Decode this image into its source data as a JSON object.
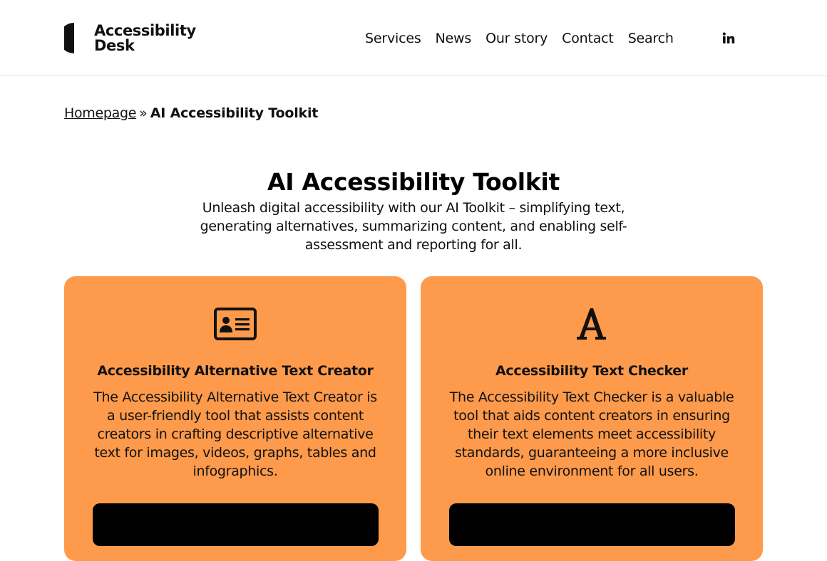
{
  "header": {
    "logo_line1": "Accessibility",
    "logo_line2": "Desk",
    "nav": [
      "Services",
      "News",
      "Our story",
      "Contact",
      "Search"
    ],
    "social_icon": "linkedin-icon"
  },
  "breadcrumb": {
    "home": "Homepage",
    "separator": "»",
    "current": "AI Accessibility Toolkit"
  },
  "hero": {
    "title": "AI Accessibility Toolkit",
    "description": "Unleash digital accessibility with our AI Toolkit – simplifying text, generating alternatives, summarizing content, and enabling self-assessment and reporting for all."
  },
  "cards": [
    {
      "icon": "id-card-icon",
      "title": "Accessibility Alternative Text Creator",
      "description": "The Accessibility Alternative Text Creator is a user-friendly tool that assists content creators in crafting descriptive alternative text for images, videos, graphs, tables and infographics."
    },
    {
      "icon": "font-letter-a-icon",
      "title": "Accessibility Text Checker",
      "description": "The Accessibility Text Checker is a valuable tool that aids content creators in ensuring their text elements meet accessibility standards, guaranteeing a more inclusive online environment for all users."
    }
  ],
  "colors": {
    "card_background": "#fd9a4b",
    "text": "#111111",
    "button": "#000000"
  }
}
